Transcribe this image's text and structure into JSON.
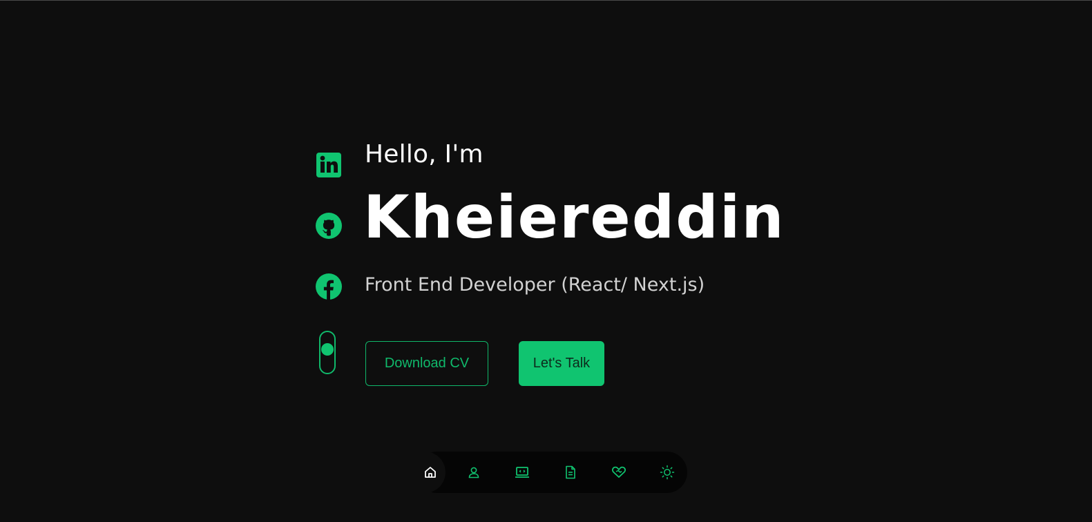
{
  "hero": {
    "greeting": "Hello, I'm",
    "name": "Kheiereddin",
    "role": "Front End Developer (React/ Next.js)"
  },
  "buttons": {
    "download_cv": "Download CV",
    "lets_talk": "Let's Talk"
  },
  "social": [
    {
      "icon": "linkedin-icon"
    },
    {
      "icon": "github-icon"
    },
    {
      "icon": "facebook-icon"
    }
  ],
  "nav": {
    "active": "home",
    "items": [
      {
        "id": "home",
        "icon": "home-icon"
      },
      {
        "id": "about",
        "icon": "user-icon"
      },
      {
        "id": "projects",
        "icon": "laptop-code-icon"
      },
      {
        "id": "resume",
        "icon": "document-icon"
      },
      {
        "id": "contact",
        "icon": "handshake-heart-icon"
      },
      {
        "id": "theme",
        "icon": "sun-icon"
      }
    ]
  },
  "colors": {
    "accent": "#10c470",
    "background": "#0e0e0e",
    "nav_background": "#050505",
    "text": "#ffffff",
    "subtext": "#d2d2d2"
  }
}
